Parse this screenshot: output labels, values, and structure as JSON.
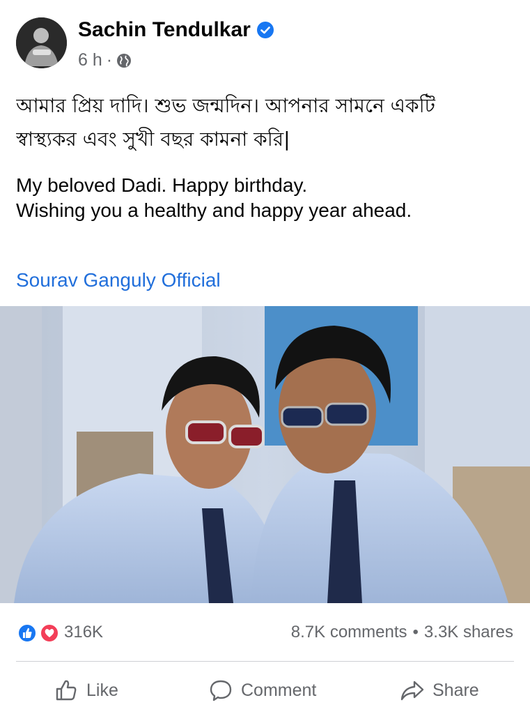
{
  "post": {
    "author": "Sachin Tendulkar",
    "time": "6 h",
    "dot": "·",
    "text_bengali": [
      "আমার প্রিয় দাদি। শুভ জন্মদিন। আপনার সামনে একটি",
      "স্বাস্থ্যকর এবং সুখী বছর কামনা করি|"
    ],
    "text_english": [
      "My beloved Dadi. Happy birthday.",
      "Wishing you a healthy and happy year ahead."
    ],
    "tag": "Sourav Ganguly Official",
    "icons": {
      "verified": "verified-badge-icon",
      "privacy": "globe-icon"
    }
  },
  "engagement": {
    "reactions_count": "316K",
    "comments": "8.7K comments",
    "separator": "•",
    "shares": "3.3K shares",
    "reaction_icons": [
      "like-reaction-icon",
      "love-reaction-icon"
    ]
  },
  "actions": {
    "like": "Like",
    "comment": "Comment",
    "share": "Share"
  },
  "colors": {
    "link": "#216fdb",
    "muted": "#65676b",
    "verified": "#1877f2",
    "love": "#f33e58",
    "divider": "#ced0d4"
  }
}
